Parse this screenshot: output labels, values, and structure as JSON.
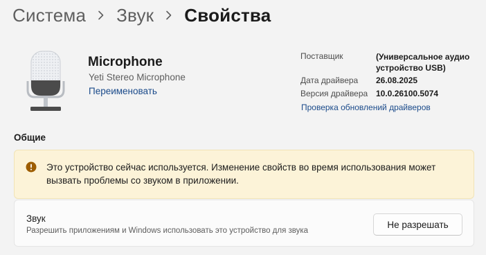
{
  "breadcrumb": {
    "items": [
      "Система",
      "Звук",
      "Свойства"
    ]
  },
  "device": {
    "name": "Microphone",
    "subtitle": "Yeti Stereo Microphone",
    "rename_label": "Переименовать",
    "icon": "microphone-icon"
  },
  "driver": {
    "provider_label": "Поставщик",
    "provider_value_line1": "(Универсальное аудио",
    "provider_value_line2": "устройство USB)",
    "date_label": "Дата драйвера",
    "date_value": "26.08.2025",
    "version_label": "Версия драйвера",
    "version_value": "10.0.26100.5074",
    "check_updates_label": "Проверка обновлений драйверов"
  },
  "general": {
    "title": "Общие",
    "warning": {
      "icon": "warning-icon",
      "text": "Это устройство сейчас используется. Изменение свойств во время использования может вызвать проблемы со звуком в приложении."
    },
    "sound": {
      "title": "Звук",
      "description": "Разрешить приложениям и Windows использовать это устройство для звука",
      "button_label": "Не разрешать"
    }
  },
  "colors": {
    "link": "#1a4a8a",
    "warning_bg": "#fcf3d8",
    "warning_icon": "#9d5d00"
  }
}
